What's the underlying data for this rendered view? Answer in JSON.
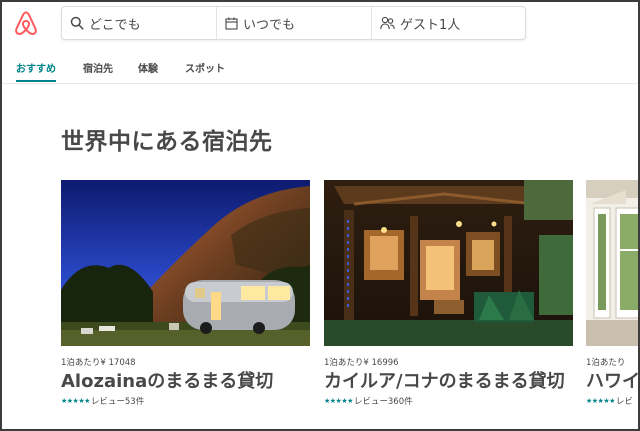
{
  "search": {
    "where_placeholder": "どこでも",
    "when_placeholder": "いつでも",
    "guests_placeholder": "ゲスト1人"
  },
  "nav": {
    "tabs": [
      {
        "label": "おすすめ",
        "active": true
      },
      {
        "label": "宿泊先",
        "active": false
      },
      {
        "label": "体験",
        "active": false
      },
      {
        "label": "スポット",
        "active": false
      }
    ]
  },
  "section": {
    "title": "世界中にある宿泊先"
  },
  "listings": [
    {
      "price": "1泊あたり¥ 17048",
      "title": "Alozainaのまるまる貸切",
      "stars": "★★★★★",
      "reviews": "レビュー53件"
    },
    {
      "price": "1泊あたり¥ 16996",
      "title": "カイルア/コナのまるまる貸切",
      "stars": "★★★★★",
      "reviews": "レビュー360件"
    },
    {
      "price": "1泊あたり",
      "title": "ハワイ",
      "stars": "★★★★★",
      "reviews": "レビ"
    }
  ],
  "colors": {
    "brand": "#ff5a5f",
    "accent": "#008489",
    "text": "#484848"
  }
}
